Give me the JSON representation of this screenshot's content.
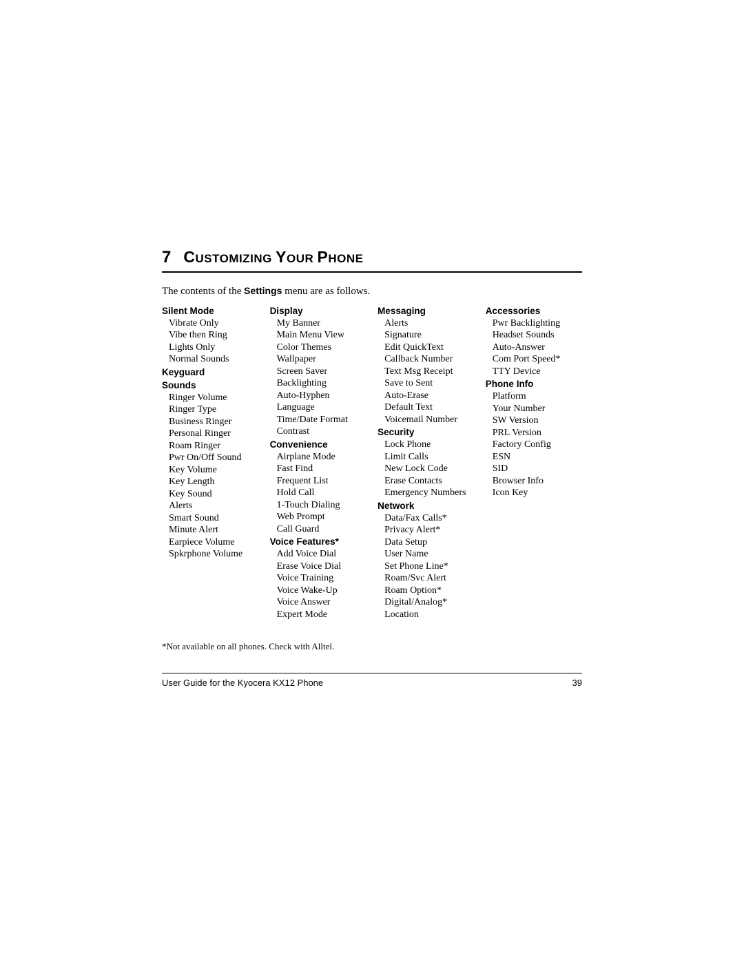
{
  "chapter_number": "7",
  "chapter_title": "CUSTOMIZING YOUR PHONE",
  "chapter_title_rest": "USTOMIZING ",
  "chapter_title_y": "Y",
  "chapter_title_our": "OUR ",
  "chapter_title_p": "P",
  "chapter_title_hone": "HONE",
  "intro_pre": "The contents of the ",
  "intro_bold": "Settings",
  "intro_post": " menu are as follows.",
  "columns": [
    [
      {
        "type": "h",
        "text": "Silent Mode"
      },
      {
        "type": "i",
        "text": "Vibrate Only"
      },
      {
        "type": "i",
        "text": "Vibe then Ring"
      },
      {
        "type": "i",
        "text": "Lights Only"
      },
      {
        "type": "i",
        "text": "Normal Sounds"
      },
      {
        "type": "h",
        "text": "Keyguard"
      },
      {
        "type": "h",
        "text": "Sounds"
      },
      {
        "type": "i",
        "text": "Ringer Volume"
      },
      {
        "type": "i",
        "text": "Ringer Type"
      },
      {
        "type": "i",
        "text": "Business Ringer"
      },
      {
        "type": "i",
        "text": "Personal Ringer"
      },
      {
        "type": "i",
        "text": "Roam Ringer"
      },
      {
        "type": "i",
        "text": "Pwr On/Off Sound"
      },
      {
        "type": "i",
        "text": "Key Volume"
      },
      {
        "type": "i",
        "text": "Key Length"
      },
      {
        "type": "i",
        "text": "Key Sound"
      },
      {
        "type": "i",
        "text": "Alerts"
      },
      {
        "type": "i",
        "text": "Smart Sound"
      },
      {
        "type": "i",
        "text": "Minute Alert"
      },
      {
        "type": "i",
        "text": "Earpiece Volume"
      },
      {
        "type": "i",
        "text": "Spkrphone Volume"
      }
    ],
    [
      {
        "type": "h",
        "text": "Display"
      },
      {
        "type": "i",
        "text": "My Banner"
      },
      {
        "type": "i",
        "text": "Main Menu View"
      },
      {
        "type": "i",
        "text": "Color Themes"
      },
      {
        "type": "i",
        "text": "Wallpaper"
      },
      {
        "type": "i",
        "text": "Screen Saver"
      },
      {
        "type": "i",
        "text": "Backlighting"
      },
      {
        "type": "i",
        "text": "Auto-Hyphen"
      },
      {
        "type": "i",
        "text": "Language"
      },
      {
        "type": "i",
        "text": "Time/Date Format"
      },
      {
        "type": "i",
        "text": "Contrast"
      },
      {
        "type": "h",
        "text": "Convenience"
      },
      {
        "type": "i",
        "text": "Airplane Mode"
      },
      {
        "type": "i",
        "text": "Fast Find"
      },
      {
        "type": "i",
        "text": "Frequent List"
      },
      {
        "type": "i",
        "text": "Hold Call"
      },
      {
        "type": "i",
        "text": "1-Touch Dialing"
      },
      {
        "type": "i",
        "text": "Web Prompt"
      },
      {
        "type": "i",
        "text": "Call Guard"
      },
      {
        "type": "h",
        "text": "Voice Features*"
      },
      {
        "type": "i",
        "text": "Add Voice Dial"
      },
      {
        "type": "i",
        "text": "Erase Voice Dial"
      },
      {
        "type": "i",
        "text": "Voice Training"
      },
      {
        "type": "i",
        "text": "Voice Wake-Up"
      },
      {
        "type": "i",
        "text": "Voice Answer"
      },
      {
        "type": "i",
        "text": "Expert Mode"
      }
    ],
    [
      {
        "type": "h",
        "text": "Messaging"
      },
      {
        "type": "i",
        "text": "Alerts"
      },
      {
        "type": "i",
        "text": "Signature"
      },
      {
        "type": "i",
        "text": "Edit QuickText"
      },
      {
        "type": "i",
        "text": "Callback Number"
      },
      {
        "type": "i",
        "text": "Text Msg Receipt"
      },
      {
        "type": "i",
        "text": "Save to Sent"
      },
      {
        "type": "i",
        "text": "Auto-Erase"
      },
      {
        "type": "i",
        "text": "Default Text"
      },
      {
        "type": "i",
        "text": "Voicemail Number"
      },
      {
        "type": "h",
        "text": "Security"
      },
      {
        "type": "i",
        "text": "Lock Phone"
      },
      {
        "type": "i",
        "text": "Limit Calls"
      },
      {
        "type": "i",
        "text": "New Lock Code"
      },
      {
        "type": "i",
        "text": "Erase Contacts"
      },
      {
        "type": "i",
        "text": "Emergency Numbers"
      },
      {
        "type": "h",
        "text": "Network"
      },
      {
        "type": "i",
        "text": "Data/Fax Calls*"
      },
      {
        "type": "i",
        "text": "Privacy Alert*"
      },
      {
        "type": "i",
        "text": "Data Setup"
      },
      {
        "type": "i",
        "text": "User Name"
      },
      {
        "type": "i",
        "text": "Set Phone Line*"
      },
      {
        "type": "i",
        "text": "Roam/Svc Alert"
      },
      {
        "type": "i",
        "text": "Roam Option*"
      },
      {
        "type": "i",
        "text": "Digital/Analog*"
      },
      {
        "type": "i",
        "text": "Location"
      }
    ],
    [
      {
        "type": "h",
        "text": "Accessories"
      },
      {
        "type": "i",
        "text": "Pwr Backlighting"
      },
      {
        "type": "i",
        "text": "Headset Sounds"
      },
      {
        "type": "i",
        "text": "Auto-Answer"
      },
      {
        "type": "i",
        "text": "Com Port Speed*"
      },
      {
        "type": "i",
        "text": "TTY Device"
      },
      {
        "type": "h",
        "text": "Phone Info"
      },
      {
        "type": "i",
        "text": "Platform"
      },
      {
        "type": "i",
        "text": "Your Number"
      },
      {
        "type": "i",
        "text": "SW Version"
      },
      {
        "type": "i",
        "text": "PRL Version"
      },
      {
        "type": "i",
        "text": "Factory Config"
      },
      {
        "type": "i",
        "text": "ESN"
      },
      {
        "type": "i",
        "text": "SID"
      },
      {
        "type": "i",
        "text": "Browser Info"
      },
      {
        "type": "i",
        "text": "Icon Key"
      }
    ]
  ],
  "footnote": "*Not available on all phones. Check with Alltel.",
  "footer_left": "User Guide for the Kyocera KX12 Phone",
  "footer_right": "39"
}
